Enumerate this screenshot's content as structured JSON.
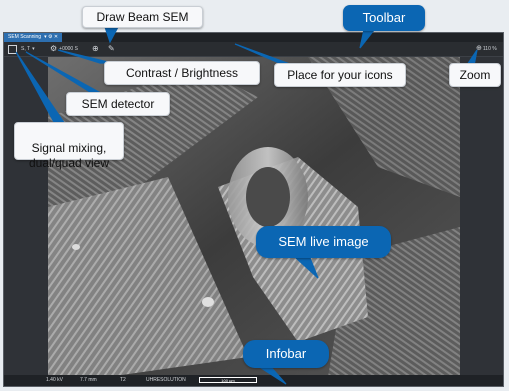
{
  "window": {
    "tab_label": "SEM Scanning",
    "tab_extra": "▾ ⚙ ✕"
  },
  "toolbar": {
    "detector_value": "S, T",
    "contrast_value": "+0000 S",
    "zoom_value": "110 %"
  },
  "infobar": {
    "hv": "1.40 kV",
    "wd": "7.7 mm",
    "det": "T2",
    "mode": "UHRESOLUTION",
    "scale": "100 µm"
  },
  "callouts": {
    "draw_beam": "Draw Beam SEM",
    "toolbar": "Toolbar",
    "contrast": "Contrast / Brightness",
    "icons_place": "Place for your icons",
    "zoom": "Zoom",
    "detector": "SEM detector",
    "signal_mixing": "Signal mixing,\ndual/quad view",
    "live_image": "SEM live image",
    "infobar": "Infobar"
  },
  "colors": {
    "callout_blue": "#0b66b3",
    "window_bg": "#2f3237",
    "tab_active": "#2d6fb0"
  },
  "icons": [
    "square-icon",
    "gear-icon",
    "beam-icon",
    "pencil-icon",
    "zoom-icon"
  ]
}
